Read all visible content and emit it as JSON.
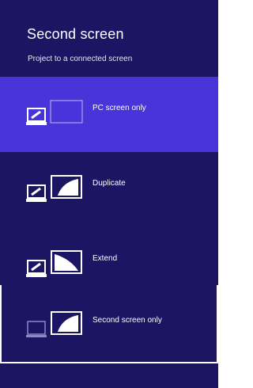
{
  "panel": {
    "title": "Second screen",
    "subtitle": "Project to a connected screen"
  },
  "options": [
    {
      "label": "PC screen only",
      "selected": true,
      "icon": "pc-screen-only-icon"
    },
    {
      "label": "Duplicate",
      "selected": false,
      "icon": "duplicate-icon"
    },
    {
      "label": "Extend",
      "selected": false,
      "icon": "extend-icon"
    },
    {
      "label": "Second screen only",
      "selected": false,
      "icon": "second-screen-only-icon"
    }
  ],
  "colors": {
    "panel_bg": "#1b1563",
    "selected_bg": "#4834d8",
    "text": "#ffffff"
  }
}
